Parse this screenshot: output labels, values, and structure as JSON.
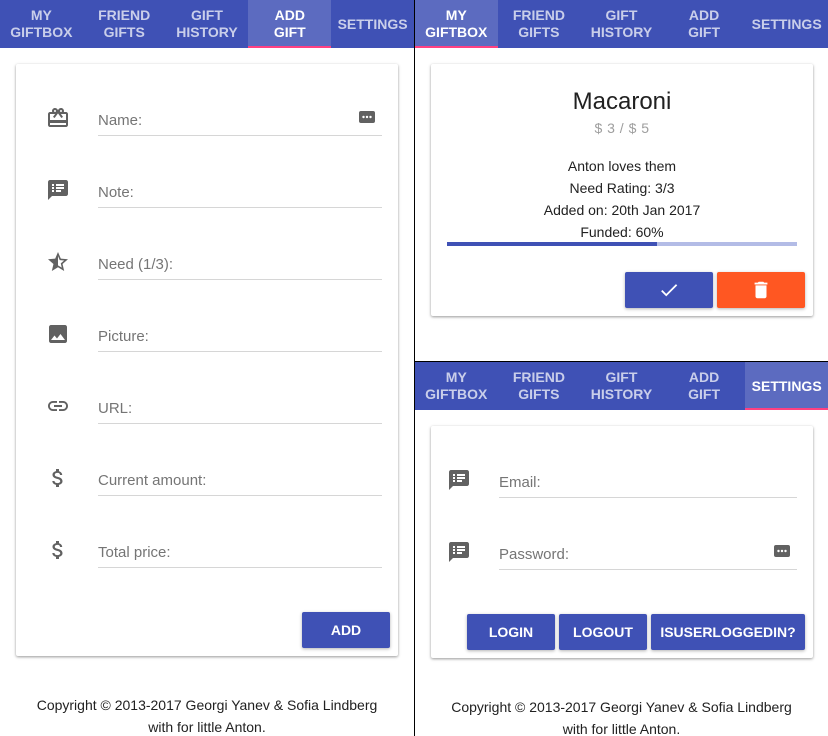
{
  "nav": {
    "tabs": [
      {
        "label": "MY\nGIFTBOX"
      },
      {
        "label": "FRIEND\nGIFTS"
      },
      {
        "label": "GIFT\nHISTORY"
      },
      {
        "label": "ADD\nGIFT"
      },
      {
        "label": "SETTINGS"
      }
    ]
  },
  "add_gift": {
    "active_tab": "ADD GIFT",
    "fields": {
      "name": "Name:",
      "note": "Note:",
      "need": "Need (1/3):",
      "picture": "Picture:",
      "url": "URL:",
      "current_amount": "Current amount:",
      "total_price": "Total price:"
    },
    "add_button": "ADD"
  },
  "gift_card": {
    "active_tab": "MY GIFTBOX",
    "title": "Macaroni",
    "price": "$ 3 / $ 5",
    "note": "Anton loves them",
    "need_rating": "Need Rating: 3/3",
    "added_on": "Added on: 20th Jan 2017",
    "funded": "Funded: 60%",
    "funded_fraction": 0.6
  },
  "settings": {
    "active_tab": "SETTINGS",
    "email_label": "Email:",
    "password_label": "Password:",
    "login_button": "LOGIN",
    "logout_button": "LOGOUT",
    "is_logged_in_button": "ISUSERLOGGEDIN?"
  },
  "footer": {
    "line1": "Copyright © 2013-2017 Georgi Yanev & Sofia Lindberg",
    "line2": "with for little Anton."
  },
  "colors": {
    "primary": "#3f51b5",
    "accent": "#ff4081",
    "warn": "#ff5722"
  },
  "icons": {
    "name": "cake-icon",
    "note": "notes-icon",
    "need": "star-half-icon",
    "picture": "image-icon",
    "url": "link-icon",
    "currency": "dollar-icon",
    "confirm": "check-icon",
    "delete": "trash-icon",
    "autofill": "more-horizontal-icon"
  }
}
